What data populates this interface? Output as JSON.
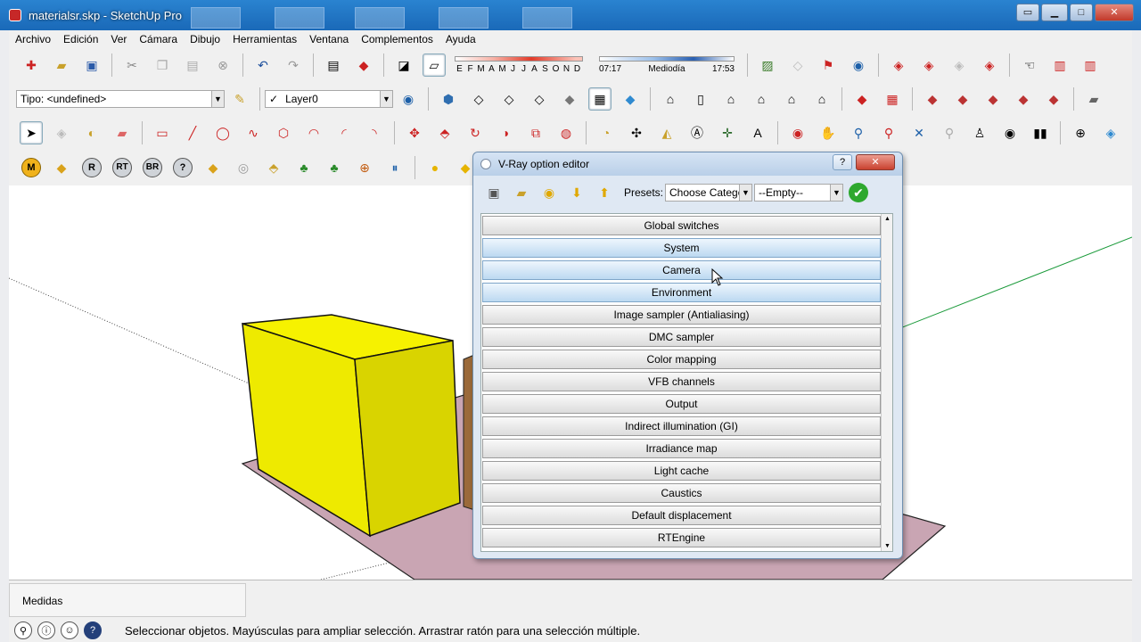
{
  "window": {
    "title": "materialsr.skp - SketchUp Pro",
    "minimize": "▭",
    "maximize": "□",
    "close": "✕"
  },
  "menu": [
    "Archivo",
    "Edición",
    "Ver",
    "Cámara",
    "Dibujo",
    "Herramientas",
    "Ventana",
    "Complementos",
    "Ayuda"
  ],
  "toolbar": {
    "tag_combo": "Tipo: <undefined>",
    "layer_check": "✓",
    "layer_combo": "Layer0",
    "months": [
      "E",
      "F",
      "M",
      "A",
      "M",
      "J",
      "J",
      "A",
      "S",
      "O",
      "N",
      "D"
    ],
    "time_start": "07:17",
    "time_mid": "Mediodía",
    "time_end": "17:53",
    "vray_buttons": [
      "M",
      "R",
      "RT",
      "BR",
      "?"
    ]
  },
  "vray_dialog": {
    "title": "V-Ray option editor",
    "help": "?",
    "close": "✕",
    "presets_label": "Presets:",
    "preset_category": "Choose Categor",
    "preset_value": "--Empty--",
    "items": [
      {
        "label": "Global switches",
        "highlight": false
      },
      {
        "label": "System",
        "highlight": true
      },
      {
        "label": "Camera",
        "highlight": true
      },
      {
        "label": "Environment",
        "highlight": true
      },
      {
        "label": "Image sampler (Antialiasing)",
        "highlight": false
      },
      {
        "label": "DMC sampler",
        "highlight": false
      },
      {
        "label": "Color mapping",
        "highlight": false
      },
      {
        "label": "VFB channels",
        "highlight": false
      },
      {
        "label": "Output",
        "highlight": false
      },
      {
        "label": "Indirect illumination (GI)",
        "highlight": false
      },
      {
        "label": "Irradiance map",
        "highlight": false
      },
      {
        "label": "Light cache",
        "highlight": false
      },
      {
        "label": "Caustics",
        "highlight": false
      },
      {
        "label": "Default displacement",
        "highlight": false
      },
      {
        "label": "RTEngine",
        "highlight": false
      }
    ]
  },
  "status": {
    "measures_label": "Medidas",
    "message": "Seleccionar objetos. Mayúsculas para ampliar selección. Arrastrar ratón para una selección múltiple."
  },
  "colors": {
    "accent": "#1a69b8",
    "box_yellow": "#f6f200",
    "ground": "#c9a5b3"
  }
}
